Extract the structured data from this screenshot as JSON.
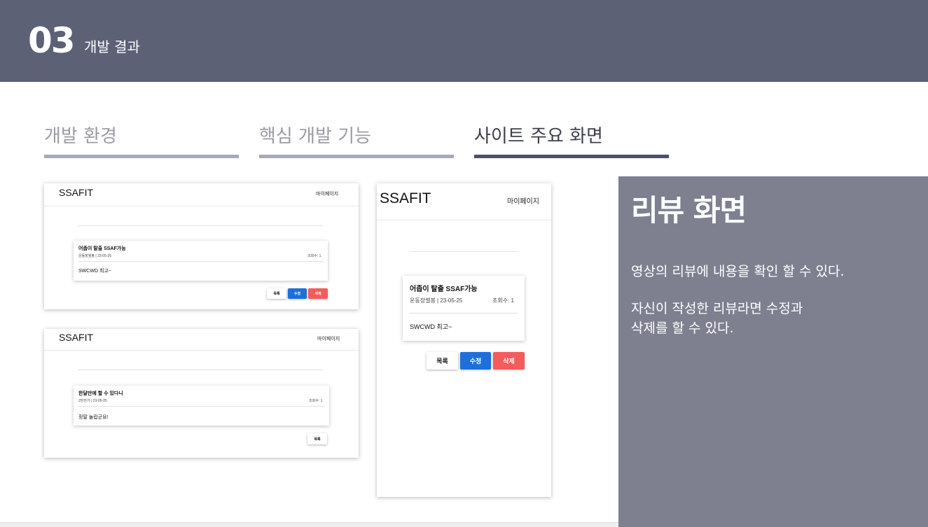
{
  "header": {
    "number": "03",
    "title": "개발 결과"
  },
  "tabs": [
    {
      "label": "개발 환경",
      "active": false
    },
    {
      "label": "핵심 개발 기능",
      "active": false
    },
    {
      "label": "사이트 주요 화면",
      "active": true
    }
  ],
  "shot1": {
    "logo": "SSAFIT",
    "mypage": "마이페이지",
    "review_title": "어좁이 탈출 SSAF가능",
    "meta": "운동장썰봉 | 23-05-25",
    "views": "조회수: 1",
    "body": "SWCWD 최고~",
    "btn_list": "목록",
    "btn_edit": "수정",
    "btn_delete": "삭제"
  },
  "shot2": {
    "logo": "SSAFIT",
    "mypage": "마이페이지",
    "review_title": "한달만에 할 수 있다니",
    "meta": "2반전가 | 23-05-25",
    "views": "조회수: 1",
    "body": "정말 놀랍군요!",
    "btn_list": "목록"
  },
  "shot3": {
    "logo": "SSAFIT",
    "mypage": "마이페이지",
    "review_title": "어좁이 탈출 SSAF가능",
    "meta": "운동장썰봉 | 23-05-25",
    "views": "조회수: 1",
    "body": "SWCWD 최고~",
    "btn_list": "목록",
    "btn_edit": "수정",
    "btn_delete": "삭제"
  },
  "info": {
    "title": "리뷰 화면",
    "desc_line1": "영상의 리뷰에 내용을 확인 할 수 있다.",
    "desc_line2": "자신이 작성한 리뷰라면 수정과",
    "desc_line3": "삭제를 할 수 있다."
  },
  "colors": {
    "header_bg": "#5c6176",
    "panel_bg": "#7e8090",
    "edit_blue": "#1e6fd9",
    "delete_red": "#f45b5b"
  }
}
